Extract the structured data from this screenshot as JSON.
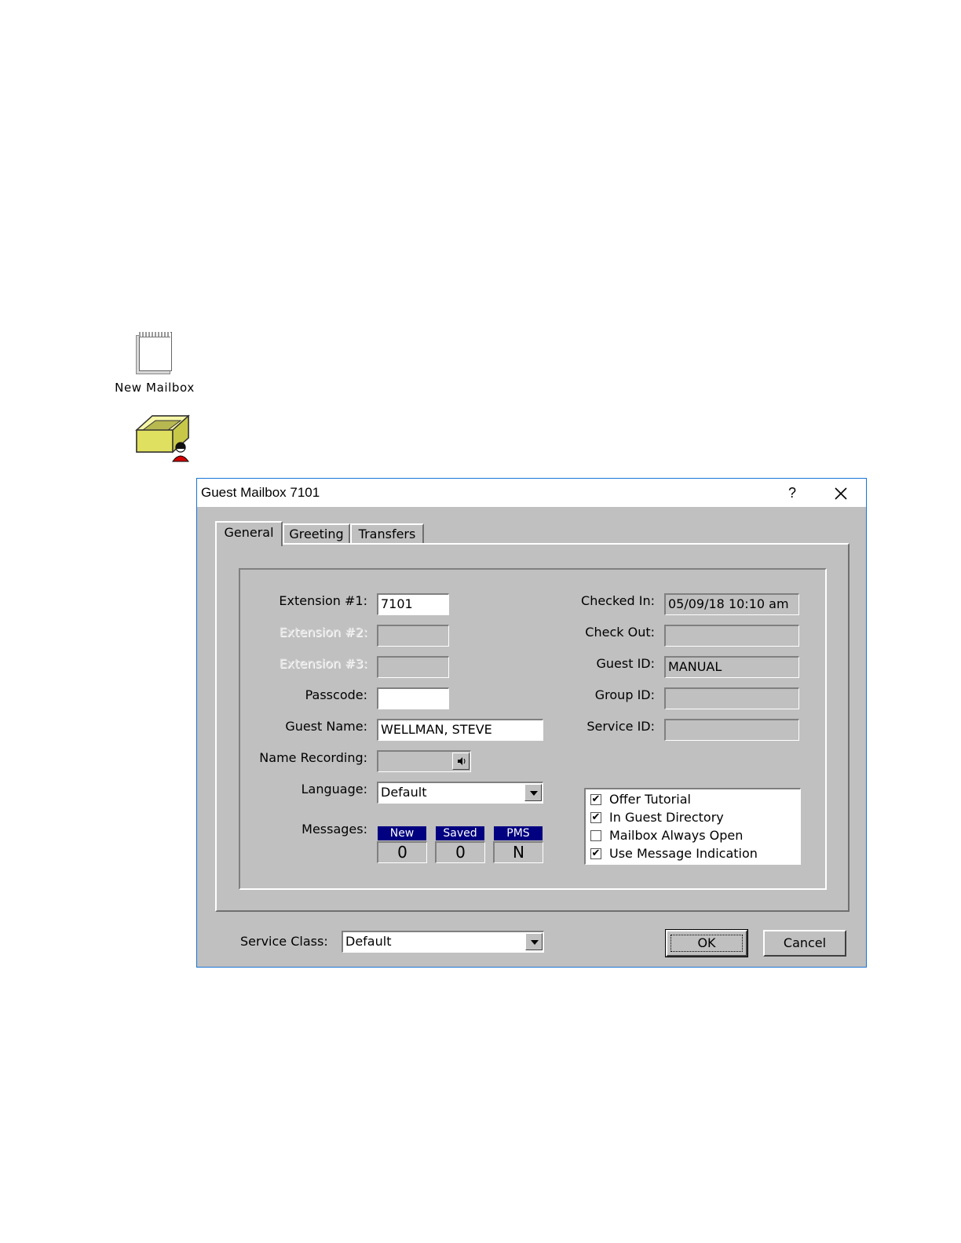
{
  "desktop": {
    "new_mailbox_label": "New Mailbox"
  },
  "dialog": {
    "title": "Guest Mailbox 7101",
    "help_glyph": "?",
    "tabs": [
      {
        "label": "General",
        "active": true
      },
      {
        "label": "Greeting",
        "active": false
      },
      {
        "label": "Transfers",
        "active": false
      }
    ],
    "left_fields": {
      "extension1": {
        "label": "Extension #1:",
        "value": "7101"
      },
      "extension2": {
        "label": "Extension #2:",
        "value": ""
      },
      "extension3": {
        "label": "Extension #3:",
        "value": ""
      },
      "passcode": {
        "label": "Passcode:",
        "value": ""
      },
      "guest_name": {
        "label": "Guest Name:",
        "value": "WELLMAN, STEVE"
      },
      "name_recording": {
        "label": "Name Recording:",
        "value": ""
      },
      "language": {
        "label": "Language:",
        "value": "Default"
      },
      "messages": {
        "label": "Messages:"
      }
    },
    "messages": {
      "new": {
        "header": "New",
        "value": "0"
      },
      "saved": {
        "header": "Saved",
        "value": "0"
      },
      "pms": {
        "header": "PMS",
        "value": "N"
      }
    },
    "right_fields": {
      "checked_in": {
        "label": "Checked In:",
        "value": "05/09/18 10:10 am"
      },
      "check_out": {
        "label": "Check Out:",
        "value": ""
      },
      "guest_id": {
        "label": "Guest ID:",
        "value": "MANUAL"
      },
      "group_id": {
        "label": "Group ID:",
        "value": ""
      },
      "service_id": {
        "label": "Service ID:",
        "value": ""
      }
    },
    "options": [
      {
        "label": "Offer Tutorial",
        "checked": true
      },
      {
        "label": "In Guest Directory",
        "checked": true
      },
      {
        "label": "Mailbox Always Open",
        "checked": false
      },
      {
        "label": "Use Message Indication",
        "checked": true
      }
    ],
    "service_class": {
      "label": "Service Class:",
      "value": "Default"
    },
    "buttons": {
      "ok": "OK",
      "cancel": "Cancel"
    }
  },
  "colors": {
    "dialog_bg": "#c0c0c0",
    "dialog_border": "#1874d6",
    "message_header_bg": "#000080"
  }
}
